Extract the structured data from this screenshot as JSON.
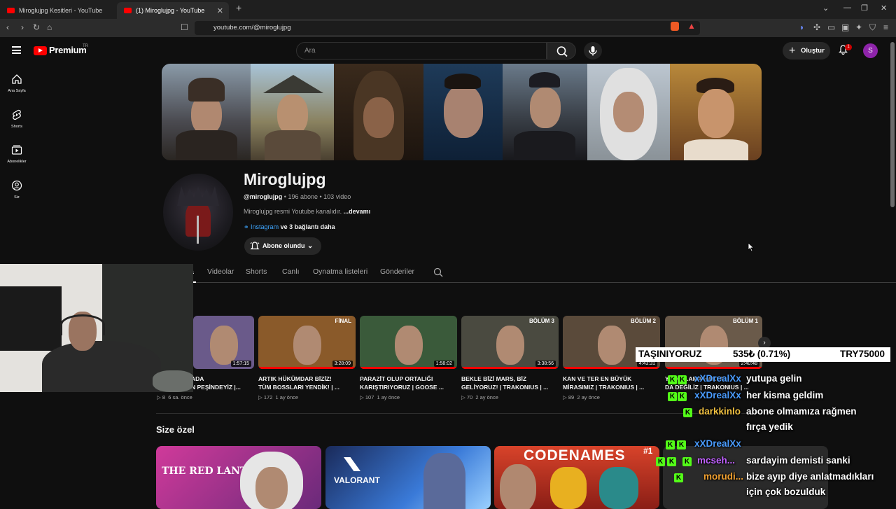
{
  "browser": {
    "tabs": [
      {
        "title": "Miroglujpg Kesitleri - YouTube",
        "active": false
      },
      {
        "title": "(1) Miroglujpg - YouTube",
        "active": true
      }
    ],
    "address": "youtube.com/@miroglujpg"
  },
  "header": {
    "logo_text": "Premium",
    "logo_region": "TR",
    "search_placeholder": "Ara",
    "create_label": "Oluştur",
    "notif_count": "1",
    "avatar_letter": "S"
  },
  "sidebar": {
    "items": [
      {
        "label": "Ana Sayfa",
        "icon": "home-icon"
      },
      {
        "label": "Shorts",
        "icon": "shorts-icon"
      },
      {
        "label": "Abonelikler",
        "icon": "subscriptions-icon"
      },
      {
        "label": "Siz",
        "icon": "you-icon"
      }
    ]
  },
  "channel": {
    "name": "Miroglujpg",
    "handle": "@miroglujpg",
    "subscribers": "196 abone",
    "videos": "103 video",
    "description": "Miroglujpg resmi Youtube kanalıdır.",
    "more": "...devamı",
    "link_main": "Instagram",
    "link_more": "ve 3 bağlantı daha",
    "subscribed_label": "Abone olundu"
  },
  "channel_tabs": [
    "a",
    "Videolar",
    "Shorts",
    "Canlı",
    "Oynatma listeleri",
    "Gönderiler"
  ],
  "shelf": [
    {
      "title_l1": "ADA",
      "title_l2": "N PEŞİNDEYİZ |...",
      "duration": "1:57:15",
      "tag": "",
      "views": "8",
      "age": "6 sa. önce",
      "progress": 0.0,
      "thumb_bg": "#6a5a8a"
    },
    {
      "title_l1": "ARTIK HÜKÜMDAR BİZİZ!",
      "title_l2": "TÜM BOSSLARI YENDİK! | ...",
      "duration": "3:28:09",
      "tag": "FİNAL",
      "views": "172",
      "age": "1 ay önce",
      "progress": 1.0,
      "thumb_bg": "#8a5a2a"
    },
    {
      "title_l1": "PARAZİT OLUP ORTALIĞI",
      "title_l2": "KARIŞTIRIYORUZ | GOOSE ...",
      "duration": "1:58:02",
      "tag": "",
      "views": "107",
      "age": "1 ay önce",
      "progress": 1.0,
      "thumb_bg": "#3a5a3a"
    },
    {
      "title_l1": "BEKLE BİZİ MARS, BİZ",
      "title_l2": "GELİYORUZ! | TRAKONIUS | ...",
      "duration": "3:38:56",
      "tag": "BÖLÜM 3",
      "views": "70",
      "age": "2 ay önce",
      "progress": 1.0,
      "thumb_bg": "#4a4a40"
    },
    {
      "title_l1": "KAN VE TER EN BÜYÜK",
      "title_l2": "MİRASIMIZ | TRAKONIUS | ...",
      "duration": "4:43:31",
      "tag": "BÖLÜM 2",
      "views": "89",
      "age": "2 ay önce",
      "progress": 1.0,
      "thumb_bg": "#5a4a3a"
    },
    {
      "title_l1": "Y...DIK...AMA HAKTA",
      "title_l2": "DA DEĞİLİZ | TRAKONIUS | ...",
      "duration": "2:40:48",
      "tag": "BÖLÜM 1",
      "views": "",
      "age": "",
      "progress": 1.0,
      "thumb_bg": "#6a5a4a"
    }
  ],
  "section_title": "Size özel",
  "recommended": [
    {
      "title": "THE RED LANTERN",
      "bg": "#c0358a"
    },
    {
      "title": "VALORANT",
      "bg": "#1f4f9f"
    },
    {
      "title": "CODENAMES",
      "bg": "#c8392a",
      "badge": "#1"
    },
    {
      "title": "",
      "bg": "#2a2a2a"
    }
  ],
  "ticker": {
    "left": "TAŞINIYORUZ",
    "mid": "535₺ (0.71%)",
    "right": "TRY75000"
  },
  "chat": [
    {
      "user": "xXDrealXx",
      "user_color": "#4a9cff",
      "text": "yutupa gelin"
    },
    {
      "user": "xXDrealXx",
      "user_color": "#4a9cff",
      "text": "her kisma geldim"
    },
    {
      "user": "darkkinlo",
      "user_color": "#f0c040",
      "text": "abone olmamıza rağmen"
    },
    {
      "user": "",
      "user_color": "",
      "text": "fırça yedik"
    },
    {
      "user": "xXDrealXx",
      "user_color": "#4a9cff",
      "text": ""
    },
    {
      "user": "mcseh...",
      "user_color": "#c060ff",
      "text": "sardayim demisti sanki"
    },
    {
      "user": "morudi...",
      "user_color": "#f0a030",
      "text": "bize ayıp diye anlatmadıkları"
    },
    {
      "user": "",
      "user_color": "",
      "text": "için çok bozulduk"
    }
  ]
}
